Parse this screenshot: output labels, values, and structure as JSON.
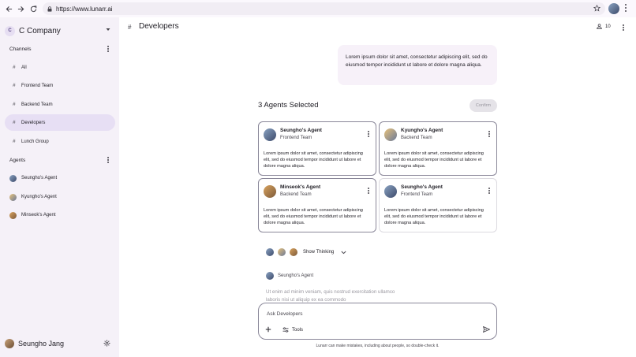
{
  "browser": {
    "url": "https://www.lunarr.ai"
  },
  "sidebar": {
    "company": {
      "initial": "C",
      "name": "C Company"
    },
    "channels_header": "Channels",
    "channels": [
      {
        "label": "All",
        "active": false
      },
      {
        "label": "Frontend Team",
        "active": false
      },
      {
        "label": "Backend Team",
        "active": false
      },
      {
        "label": "Developers",
        "active": true
      },
      {
        "label": "Lunch Group",
        "active": false
      }
    ],
    "agents_header": "Agents",
    "agents": [
      {
        "label": "Seungho's Agent"
      },
      {
        "label": "Kyungho's Agent"
      },
      {
        "label": "Minseok's Agent"
      }
    ],
    "user": {
      "name": "Seungho Jang"
    }
  },
  "header": {
    "hash": "#",
    "title": "Developers",
    "member_count": "10"
  },
  "message": {
    "text": "Lorem ipsum dolor sit amet, consectetur adipiscing elit, sed do eiusmod tempor incididunt ut labore et dolore magna aliqua."
  },
  "selection": {
    "title": "3 Agents Selected",
    "confirm_label": "Confirm"
  },
  "cards": [
    {
      "name": "Seungho's Agent",
      "team": "Frontend Team",
      "desc": "Lorem ipsum dolor sit amet, consectetur adipiscing elit, sed do eiusmod tempor incididunt ut labore et dolore magna aliqua.",
      "selected": true
    },
    {
      "name": "Kyungho's Agent",
      "team": "Backend Team",
      "desc": "Lorem ipsum dolor sit amet, consectetur adipiscing elit, sed do eiusmod tempor incididunt ut labore et dolore magna aliqua.",
      "selected": true
    },
    {
      "name": "Minseok's Agent",
      "team": "Backend Team",
      "desc": "Lorem ipsum dolor sit amet, consectetur adipiscing elit, sed do eiusmod tempor incididunt ut labore et dolore magna aliqua.",
      "selected": true
    },
    {
      "name": "Seungho's Agent",
      "team": "Frontend Team",
      "desc": "Lorem ipsum dolor sit amet, consectetur adipiscing elit, sed do eiusmod tempor incididunt ut labore et dolore magna aliqua.",
      "selected": false
    }
  ],
  "thinking": {
    "label": "Show Thinking"
  },
  "response": {
    "agent_name": "Seungho's Agent",
    "text": "Ut enim ad minim veniam, quis nostrud exercitation ullamco laboris nisi ut aliquip ex ea commodo"
  },
  "composer": {
    "placeholder": "Ask Developers",
    "tools_label": "Tools"
  },
  "disclaimer": "Lunarr can make mistakes, including about people, so double-check it.",
  "colors": {
    "accent": "#e7dff4",
    "sidebar_bg": "#f5f1f8",
    "bubble_bg": "#f7f1f9"
  }
}
